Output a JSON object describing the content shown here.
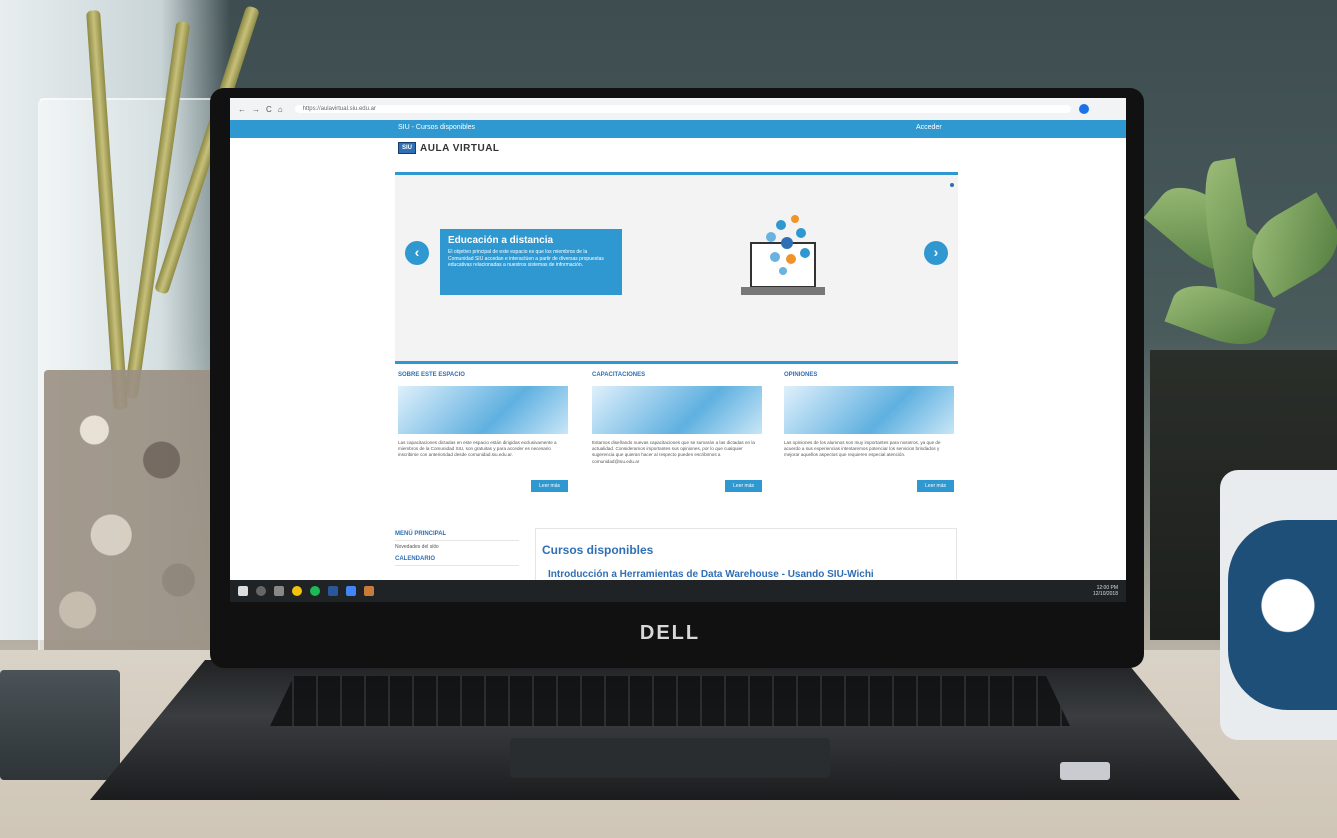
{
  "browser": {
    "url": "https://aulavirtual.siu.edu.ar",
    "nav_icons": [
      "back-icon",
      "forward-icon",
      "reload-icon",
      "home-icon"
    ]
  },
  "site": {
    "header_title": "SIU - Cursos disponibles",
    "login_link": "Acceder",
    "logo_badge": "SIU",
    "logo_text": "AULA VIRTUAL"
  },
  "slider": {
    "title": "Educación a distancia",
    "text": "El objetivo principal de este espacio es que los miembros de la Comunidad SIU accedan e interactúen a partir de diversas propuestas educativas relacionadas a nuestros sistemas de información.",
    "prev": "‹",
    "next": "›"
  },
  "sections": [
    {
      "title": "SOBRE ESTE ESPACIO",
      "text": "Las capacitaciones dictadas en este espacio están dirigidas exclusivamente a miembros de la Comunidad SIU, son gratuitas y para acceder es necesario inscribirse con anterioridad desde comunidad.siu.edu.ar.",
      "button": "Leer más"
    },
    {
      "title": "CAPACITACIONES",
      "text": "Estamos diseñando nuevas capacitaciones que se sumarán a las dictadas en la actualidad. Consideramos importantes sus opiniones, por lo que cualquier sugerencia que quieran hacer al respecto pueden escribirnos a comunidad@siu.edu.ar",
      "button": "Leer más"
    },
    {
      "title": "OPINIONES",
      "text": "Las opiniones de los alumnos son muy importantes para nosotros, ya que de acuerdo a sus experiencias intentaremos potenciar los servicios brindados y mejorar aquellos aspectos que requieren especial atención.",
      "button": "Leer más"
    }
  ],
  "menu": {
    "title": "MENÚ PRINCIPAL",
    "item": "Novedades del sitio",
    "second": "CALENDARIO"
  },
  "courses": {
    "title": "Cursos disponibles",
    "first": "Introducción a Herramientas de Data Warehouse - Usando SIU-Wichi"
  },
  "taskbar": {
    "time": "12:00 PM",
    "date": "12/10/2018"
  },
  "laptop_brand": "DELL",
  "colors": {
    "accent": "#2f98d1",
    "dark_blue": "#2f6fb5"
  }
}
